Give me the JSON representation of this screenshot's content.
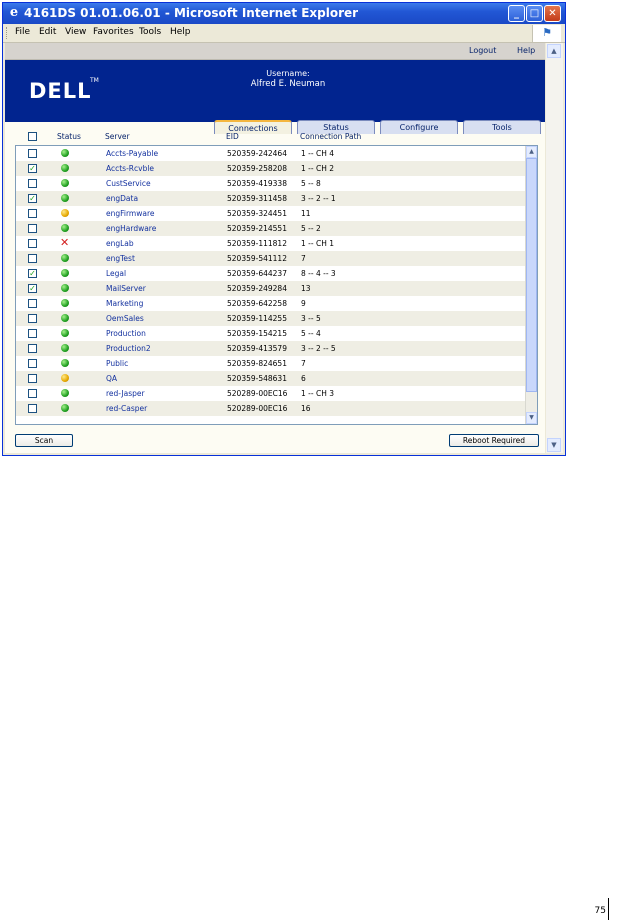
{
  "window": {
    "title": "4161DS 01.01.06.01 - Microsoft Internet Explorer",
    "minimize": "_",
    "maximize": "□",
    "close": "✕"
  },
  "menubar": {
    "items": [
      {
        "label": "File"
      },
      {
        "label": "Edit"
      },
      {
        "label": "View"
      },
      {
        "label": "Favorites"
      },
      {
        "label": "Tools"
      },
      {
        "label": "Help"
      }
    ]
  },
  "toplinks": {
    "logout": "Logout",
    "help": "Help"
  },
  "banner": {
    "logo": "DELL",
    "tm": "TM",
    "username_label": "Username:",
    "username": "Alfred E. Neuman"
  },
  "tabs": [
    {
      "label": "Connections",
      "active": true
    },
    {
      "label": "Status",
      "active": false
    },
    {
      "label": "Configure",
      "active": false
    },
    {
      "label": "Tools",
      "active": false
    }
  ],
  "table": {
    "headers": {
      "status": "Status",
      "server": "Server",
      "eid": "EID",
      "path": "Connection Path"
    },
    "rows": [
      {
        "checked": false,
        "status": "green",
        "server": "Accts-Payable",
        "eid": "520359-242464",
        "path": "1 -- CH 4"
      },
      {
        "checked": true,
        "status": "green",
        "server": "Accts-Rcvble",
        "eid": "520359-258208",
        "path": "1 -- CH 2"
      },
      {
        "checked": false,
        "status": "green",
        "server": "CustService",
        "eid": "520359-419338",
        "path": "5 -- 8"
      },
      {
        "checked": true,
        "status": "green",
        "server": "engData",
        "eid": "520359-311458",
        "path": "3 -- 2 -- 1"
      },
      {
        "checked": false,
        "status": "yellow",
        "server": "engFirmware",
        "eid": "520359-324451",
        "path": "11"
      },
      {
        "checked": false,
        "status": "green",
        "server": "engHardware",
        "eid": "520359-214551",
        "path": "5 -- 2"
      },
      {
        "checked": false,
        "status": "red-x",
        "server": "engLab",
        "eid": "520359-111812",
        "path": "1 -- CH 1"
      },
      {
        "checked": false,
        "status": "green",
        "server": "engTest",
        "eid": "520359-541112",
        "path": "7"
      },
      {
        "checked": true,
        "status": "green",
        "server": "Legal",
        "eid": "520359-644237",
        "path": "8 -- 4 -- 3"
      },
      {
        "checked": true,
        "status": "green",
        "server": "MailServer",
        "eid": "520359-249284",
        "path": "13"
      },
      {
        "checked": false,
        "status": "green",
        "server": "Marketing",
        "eid": "520359-642258",
        "path": "9"
      },
      {
        "checked": false,
        "status": "green",
        "server": "OemSales",
        "eid": "520359-114255",
        "path": "3 -- 5"
      },
      {
        "checked": false,
        "status": "green",
        "server": "Production",
        "eid": "520359-154215",
        "path": "5 -- 4"
      },
      {
        "checked": false,
        "status": "green",
        "server": "Production2",
        "eid": "520359-413579",
        "path": "3 -- 2 -- 5"
      },
      {
        "checked": false,
        "status": "green",
        "server": "Public",
        "eid": "520359-824651",
        "path": "7"
      },
      {
        "checked": false,
        "status": "yellow",
        "server": "QA",
        "eid": "520359-548631",
        "path": "6"
      },
      {
        "checked": false,
        "status": "green",
        "server": "red-Jasper",
        "eid": "520289-00EC16",
        "path": "1 -- CH 3"
      },
      {
        "checked": false,
        "status": "green",
        "server": "red-Casper",
        "eid": "520289-00EC16",
        "path": "16"
      }
    ]
  },
  "buttons": {
    "scan": "Scan",
    "reboot": "Reboot Required"
  },
  "page_number": "75",
  "colors": {
    "banner": "#01248f",
    "titlebar": "#2257d5",
    "active_tab_accent": "#f4b63f",
    "ok": "#21a121",
    "warn": "#e6a800",
    "error": "#d32020"
  }
}
